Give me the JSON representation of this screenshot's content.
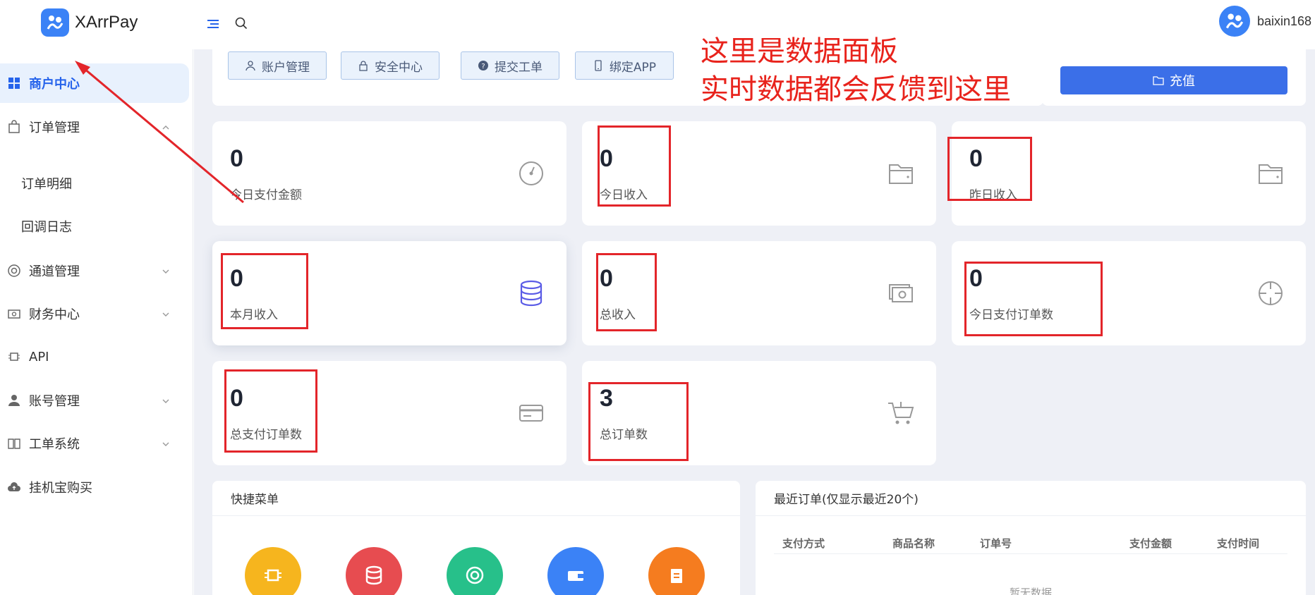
{
  "app": {
    "name": "XArrPay"
  },
  "user": {
    "name": "baixin168"
  },
  "sidebar": {
    "items": [
      {
        "label": "商户中心"
      },
      {
        "label": "订单管理"
      },
      {
        "label": "订单明细"
      },
      {
        "label": "回调日志"
      },
      {
        "label": "通道管理"
      },
      {
        "label": "财务中心"
      },
      {
        "label": "API"
      },
      {
        "label": "账号管理"
      },
      {
        "label": "工单系统"
      },
      {
        "label": "挂机宝购买"
      }
    ]
  },
  "quick_actions": [
    {
      "label": "账户管理"
    },
    {
      "label": "安全中心"
    },
    {
      "label": "提交工单"
    },
    {
      "label": "绑定APP"
    }
  ],
  "recharge": {
    "label": "充值"
  },
  "annotation": {
    "line1": "这里是数据面板",
    "line2": "实时数据都会反馈到这里"
  },
  "stats": [
    {
      "value": "0",
      "label": "今日支付金额",
      "icon": "speedometer-icon"
    },
    {
      "value": "0",
      "label": "今日收入",
      "icon": "folder-icon"
    },
    {
      "value": "0",
      "label": "昨日收入",
      "icon": "folder-icon"
    },
    {
      "value": "0",
      "label": "本月收入",
      "icon": "database-icon"
    },
    {
      "value": "0",
      "label": "总收入",
      "icon": "cash-icon"
    },
    {
      "value": "0",
      "label": "今日支付订单数",
      "icon": "crosshair-icon"
    },
    {
      "value": "0",
      "label": "总支付订单数",
      "icon": "credit-card-icon"
    },
    {
      "value": "3",
      "label": "总订单数",
      "icon": "cart-icon"
    }
  ],
  "quick_menu": {
    "title": "快捷菜单"
  },
  "recent_orders": {
    "title": "最近订单(仅显示最近20个)",
    "columns": [
      "支付方式",
      "商品名称",
      "订单号",
      "支付金额",
      "支付时间"
    ],
    "empty_text": "暂无数据"
  },
  "colors": {
    "accent": "#3b6fe8",
    "annotation": "#e8231c",
    "active_bg": "#e8f1fd"
  }
}
